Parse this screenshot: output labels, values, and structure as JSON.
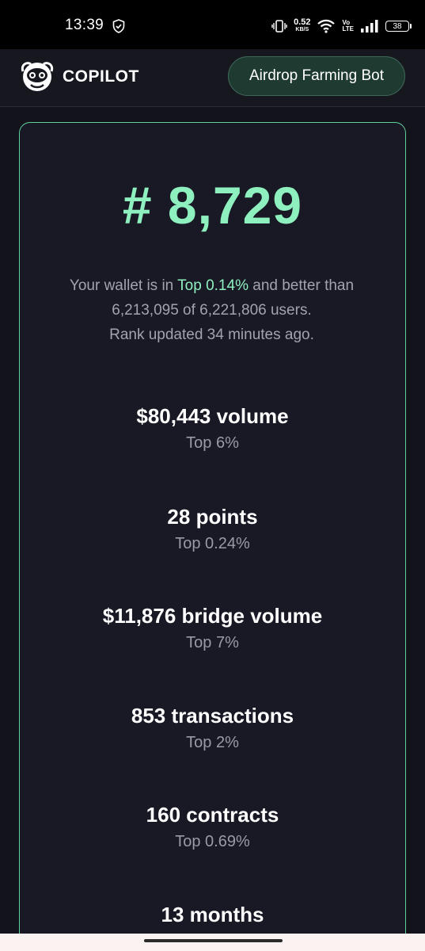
{
  "status_bar": {
    "time": "13:39",
    "net_speed_value": "0.52",
    "net_speed_unit": "KB/S",
    "volte_top": "Vo",
    "volte_bottom": "LTE",
    "battery_level": "38"
  },
  "header": {
    "brand": "COPILOT",
    "bot_button_label": "Airdrop Farming Bot"
  },
  "rank_card": {
    "rank": "# 8,729",
    "summary_part1": "Your wallet is in ",
    "summary_top": "Top 0.14%",
    "summary_part2": " and better than 6,213,095 of 6,221,806 users.",
    "summary_line3": "Rank updated 34 minutes ago."
  },
  "stats": [
    {
      "value": "$80,443 volume",
      "rank": "Top 6%"
    },
    {
      "value": "28 points",
      "rank": "Top 0.24%"
    },
    {
      "value": "$11,876 bridge volume",
      "rank": "Top 7%"
    },
    {
      "value": "853 transactions",
      "rank": "Top 2%"
    },
    {
      "value": "160 contracts",
      "rank": "Top 0.69%"
    },
    {
      "value": "13 months",
      "rank": ""
    }
  ],
  "colors": {
    "accent": "#8ff0bf",
    "card_border": "#5fcf9c",
    "background": "#13131b"
  },
  "icons": [
    "shield-icon",
    "vibrate-icon",
    "wifi-icon",
    "signal-icon",
    "battery-icon",
    "copilot-logo"
  ]
}
